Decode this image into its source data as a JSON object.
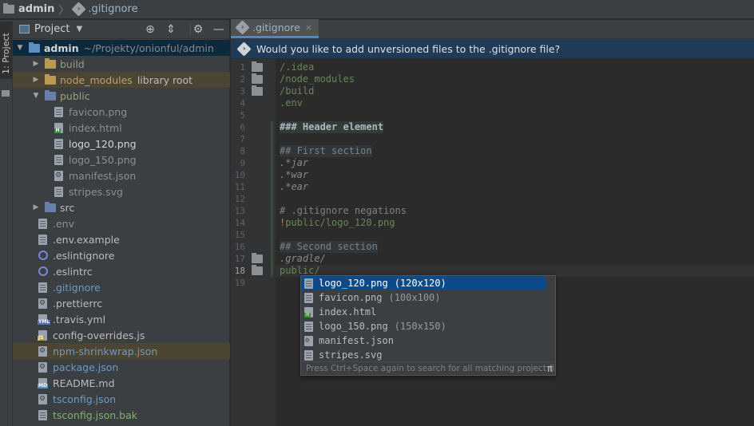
{
  "breadcrumb": {
    "root": "admin",
    "file": ".gitignore"
  },
  "toolstrip": {
    "tab_label": "1: Project"
  },
  "project_panel": {
    "title": "Project",
    "tree": [
      {
        "label": "admin",
        "extra": "~/Projekty/onionful/admin",
        "depth": 0,
        "arrow": "down",
        "icon": "folder-blue",
        "style": "strong",
        "state": "selected"
      },
      {
        "label": "build",
        "extra": "",
        "depth": 1,
        "arrow": "right",
        "icon": "folder-dim",
        "style": "ign",
        "state": ""
      },
      {
        "label": "node_modules",
        "extra": "library root",
        "depth": 1,
        "arrow": "right",
        "icon": "folder-dim",
        "style": "unv",
        "state": "highlight"
      },
      {
        "label": "public",
        "extra": "",
        "depth": 1,
        "arrow": "down",
        "icon": "folder-pub",
        "style": "dim",
        "state": ""
      },
      {
        "label": "favicon.png",
        "extra": "",
        "depth": 2,
        "arrow": "",
        "icon": "file",
        "style": "gray",
        "state": ""
      },
      {
        "label": "index.html",
        "extra": "",
        "depth": 2,
        "arrow": "",
        "icon": "html",
        "style": "gray",
        "state": ""
      },
      {
        "label": "logo_120.png",
        "extra": "",
        "depth": 2,
        "arrow": "",
        "icon": "file",
        "style": "white",
        "state": ""
      },
      {
        "label": "logo_150.png",
        "extra": "",
        "depth": 2,
        "arrow": "",
        "icon": "file",
        "style": "gray",
        "state": ""
      },
      {
        "label": "manifest.json",
        "extra": "",
        "depth": 2,
        "arrow": "",
        "icon": "gear",
        "style": "gray",
        "state": ""
      },
      {
        "label": "stripes.svg",
        "extra": "",
        "depth": 2,
        "arrow": "",
        "icon": "file",
        "style": "gray",
        "state": ""
      },
      {
        "label": "src",
        "extra": "",
        "depth": 1,
        "arrow": "right",
        "icon": "folder-pub",
        "style": "norm",
        "state": ""
      },
      {
        "label": ".env",
        "extra": "",
        "depth": 1,
        "arrow": "",
        "icon": "file",
        "style": "gray",
        "state": ""
      },
      {
        "label": ".env.example",
        "extra": "",
        "depth": 1,
        "arrow": "",
        "icon": "file",
        "style": "norm",
        "state": ""
      },
      {
        "label": ".eslintignore",
        "extra": "",
        "depth": 1,
        "arrow": "",
        "icon": "eslint",
        "style": "norm",
        "state": ""
      },
      {
        "label": ".eslintrc",
        "extra": "",
        "depth": 1,
        "arrow": "",
        "icon": "eslint",
        "style": "norm",
        "state": ""
      },
      {
        "label": ".gitignore",
        "extra": "",
        "depth": 1,
        "arrow": "",
        "icon": "file",
        "style": "blue",
        "state": ""
      },
      {
        "label": ".prettierrc",
        "extra": "",
        "depth": 1,
        "arrow": "",
        "icon": "gear",
        "style": "norm",
        "state": ""
      },
      {
        "label": ".travis.yml",
        "extra": "",
        "depth": 1,
        "arrow": "",
        "icon": "yml",
        "style": "norm",
        "state": ""
      },
      {
        "label": "config-overrides.js",
        "extra": "",
        "depth": 1,
        "arrow": "",
        "icon": "js",
        "style": "norm",
        "state": ""
      },
      {
        "label": "npm-shrinkwrap.json",
        "extra": "",
        "depth": 1,
        "arrow": "",
        "icon": "gear",
        "style": "blue",
        "state": "highlight"
      },
      {
        "label": "package.json",
        "extra": "",
        "depth": 1,
        "arrow": "",
        "icon": "gear",
        "style": "blue",
        "state": ""
      },
      {
        "label": "README.md",
        "extra": "",
        "depth": 1,
        "arrow": "",
        "icon": "md",
        "style": "norm",
        "state": ""
      },
      {
        "label": "tsconfig.json",
        "extra": "",
        "depth": 1,
        "arrow": "",
        "icon": "gear",
        "style": "blue",
        "state": ""
      },
      {
        "label": "tsconfig.json.bak",
        "extra": "",
        "depth": 1,
        "arrow": "",
        "icon": "file",
        "style": "green",
        "state": ""
      }
    ]
  },
  "editor": {
    "tab": {
      "name": ".gitignore",
      "close": "×"
    },
    "banner": "Would you like to add unversioned files to the .gitignore file?",
    "lines": [
      {
        "n": "1",
        "text": "/.idea",
        "kind": "path",
        "fold": true,
        "chg": false,
        "cur": false
      },
      {
        "n": "2",
        "text": "/node_modules",
        "kind": "path",
        "fold": true,
        "chg": false,
        "cur": false
      },
      {
        "n": "3",
        "text": "/build",
        "kind": "path",
        "fold": true,
        "chg": false,
        "cur": false
      },
      {
        "n": "4",
        "text": ".env",
        "kind": "path",
        "fold": false,
        "chg": false,
        "cur": false
      },
      {
        "n": "5",
        "text": "",
        "kind": "path",
        "fold": false,
        "chg": false,
        "cur": false
      },
      {
        "n": "6",
        "text": "### Header element",
        "kind": "head",
        "fold": false,
        "chg": true,
        "cur": false
      },
      {
        "n": "7",
        "text": "",
        "kind": "path",
        "fold": false,
        "chg": true,
        "cur": false
      },
      {
        "n": "8",
        "text": "## First section",
        "kind": "sec",
        "fold": false,
        "chg": true,
        "cur": false
      },
      {
        "n": "9",
        "text": ".*jar",
        "kind": "ital",
        "fold": false,
        "chg": true,
        "cur": false
      },
      {
        "n": "10",
        "text": ".*war",
        "kind": "ital",
        "fold": false,
        "chg": true,
        "cur": false
      },
      {
        "n": "11",
        "text": ".*ear",
        "kind": "ital",
        "fold": false,
        "chg": true,
        "cur": false
      },
      {
        "n": "12",
        "text": "",
        "kind": "path",
        "fold": false,
        "chg": true,
        "cur": false
      },
      {
        "n": "13",
        "text": "# .gitignore negations",
        "kind": "com",
        "fold": false,
        "chg": true,
        "cur": false
      },
      {
        "n": "14",
        "text": "!public/logo_120.png",
        "kind": "neg",
        "fold": false,
        "chg": true,
        "cur": false
      },
      {
        "n": "15",
        "text": "",
        "kind": "path",
        "fold": false,
        "chg": true,
        "cur": false
      },
      {
        "n": "16",
        "text": "## Second section",
        "kind": "sec",
        "fold": false,
        "chg": true,
        "cur": false
      },
      {
        "n": "17",
        "text": ".gradle/",
        "kind": "ital",
        "fold": true,
        "chg": true,
        "cur": false
      },
      {
        "n": "18",
        "text": "public/",
        "kind": "path",
        "fold": true,
        "chg": true,
        "cur": true
      },
      {
        "n": "19",
        "text": "",
        "kind": "path",
        "fold": false,
        "chg": false,
        "cur": false
      }
    ]
  },
  "completion": {
    "items": [
      {
        "name": "logo_120.png",
        "detail": "(120x120)",
        "icon": "file",
        "selected": true
      },
      {
        "name": "favicon.png",
        "detail": "(100x100)",
        "icon": "file",
        "selected": false
      },
      {
        "name": "index.html",
        "detail": "",
        "icon": "html",
        "selected": false
      },
      {
        "name": "logo_150.png",
        "detail": "(150x150)",
        "icon": "file",
        "selected": false
      },
      {
        "name": "manifest.json",
        "detail": "",
        "icon": "gear",
        "selected": false
      },
      {
        "name": "stripes.svg",
        "detail": "",
        "icon": "file",
        "selected": false
      }
    ],
    "hint": "Press Ctrl+Space again to search for all matching project files",
    "hint_symbol": "π"
  }
}
